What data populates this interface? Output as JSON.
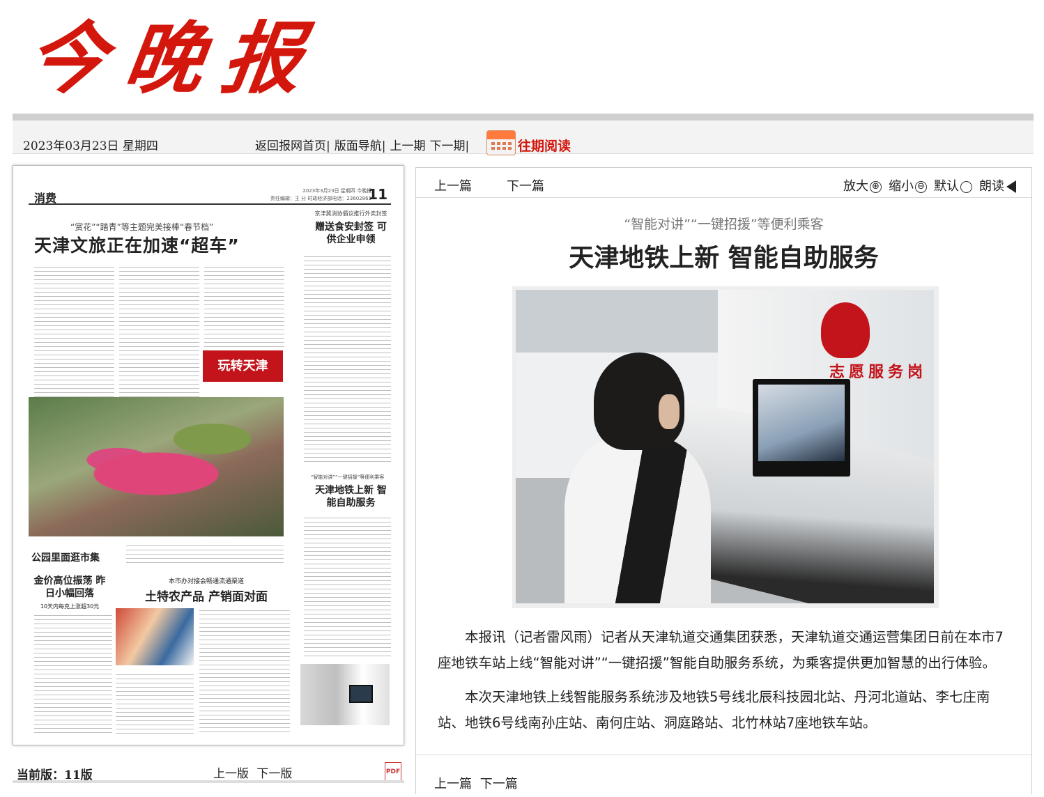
{
  "masthead": {
    "logo_text": "今晚报"
  },
  "topbar": {
    "date": "2023年03月23日 星期四",
    "nav": [
      "返回报网首页|",
      "版面导航|",
      "上一期",
      "下一期|"
    ],
    "archive_label": "往期阅读",
    "archive_icon": "calendar-icon"
  },
  "page_thumb": {
    "section": "消费",
    "page_info": "2023年3月23日 星期四 今晚报",
    "editor_line": "责任编辑：王 分  时政经济部电话：23602861",
    "page_number": "11",
    "kicker1": "“赏花”“踏青”等主题完美接棒“春节档”",
    "headline1": "天津文旅正在加速“超车”",
    "badge": "玩转天津",
    "photo_caption": "公园里面逛市集",
    "side1_kicker": "京津冀消协倡议推行外卖封签",
    "side1_head": "赠送食安封签 可供企业申领",
    "side2_kicker": "“智能对讲”“一键招援”等便利乘客",
    "side2_head": "天津地铁上新 智能自助服务",
    "gold_head": "金价高位振荡 昨日小幅回落",
    "gold_sub": "10天内每克上涨超30元",
    "farm_kicker": "本市办对接会畅通流通渠道",
    "farm_head": "土特农产品 产销面对面"
  },
  "left_footer": {
    "current_label": "当前版：",
    "current_value": "11版",
    "prev": "上一版",
    "next": "下一版",
    "pdf_icon": "PDF"
  },
  "article": {
    "prev": "上一篇",
    "next": "下一篇",
    "tools": [
      {
        "label": "放大",
        "icon": "⊕"
      },
      {
        "label": "缩小",
        "icon": "⊖"
      },
      {
        "label": "默认",
        "icon": "○"
      },
      {
        "label": "朗读",
        "icon": "speaker-icon"
      }
    ],
    "subtitle": "“智能对讲”“一键招援”等便利乘客",
    "title": "天津地铁上新 智能自助服务",
    "photo_sign": "志愿服务岗",
    "paragraphs": [
      "本报讯（记者雷风雨）记者从天津轨道交通集团获悉，天津轨道交通运营集团日前在本市7座地铁车站上线“智能对讲”“一键招援”智能自助服务系统，为乘客提供更加智慧的出行体验。",
      "本次天津地铁上线智能服务系统涉及地铁5号线北辰科技园北站、丹河北道站、李七庄南站、地铁6号线南孙庄站、南何庄站、洞庭路站、北竹林站7座地铁车站。"
    ],
    "footer_prev": "上一篇",
    "footer_next": "下一篇"
  },
  "colors": {
    "brand_red": "#d3170d",
    "bar_gray": "#f3f3f3"
  }
}
